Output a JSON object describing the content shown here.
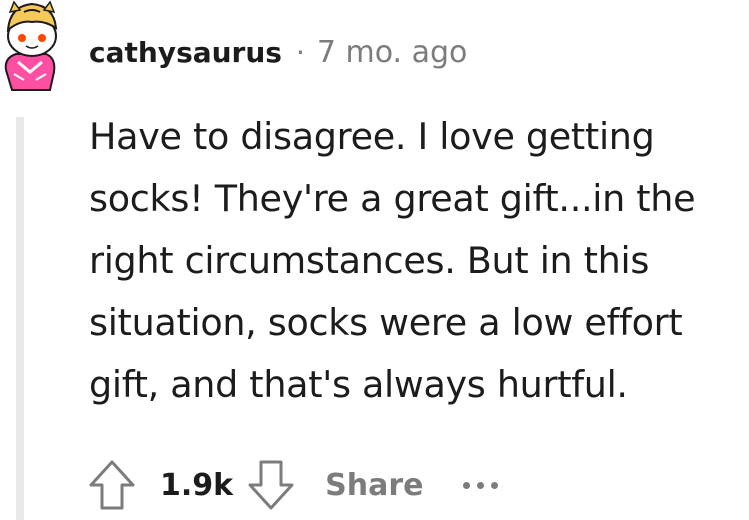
{
  "comment": {
    "author": "cathysaurus",
    "separator": "·",
    "timestamp": "7 mo. ago",
    "body": "Have to disagree. I love getting socks! They're a great gift...in the right circumstances. But in this situation, socks were a low effort gift, and that's always hurtful.",
    "score": "1.9k",
    "share_label": "Share"
  },
  "icons": {
    "avatar": "snoo-avatar-icon",
    "upvote": "arrow-up-icon",
    "downvote": "arrow-down-icon",
    "more": "more-options-icon"
  },
  "colors": {
    "text": "#1c1c1c",
    "muted": "#7c7c7c",
    "thread_line": "#e9e9e9",
    "avatar_hat": "#f5c85a",
    "avatar_shirt": "#ff4fa3",
    "avatar_eye": "#ff4500"
  }
}
